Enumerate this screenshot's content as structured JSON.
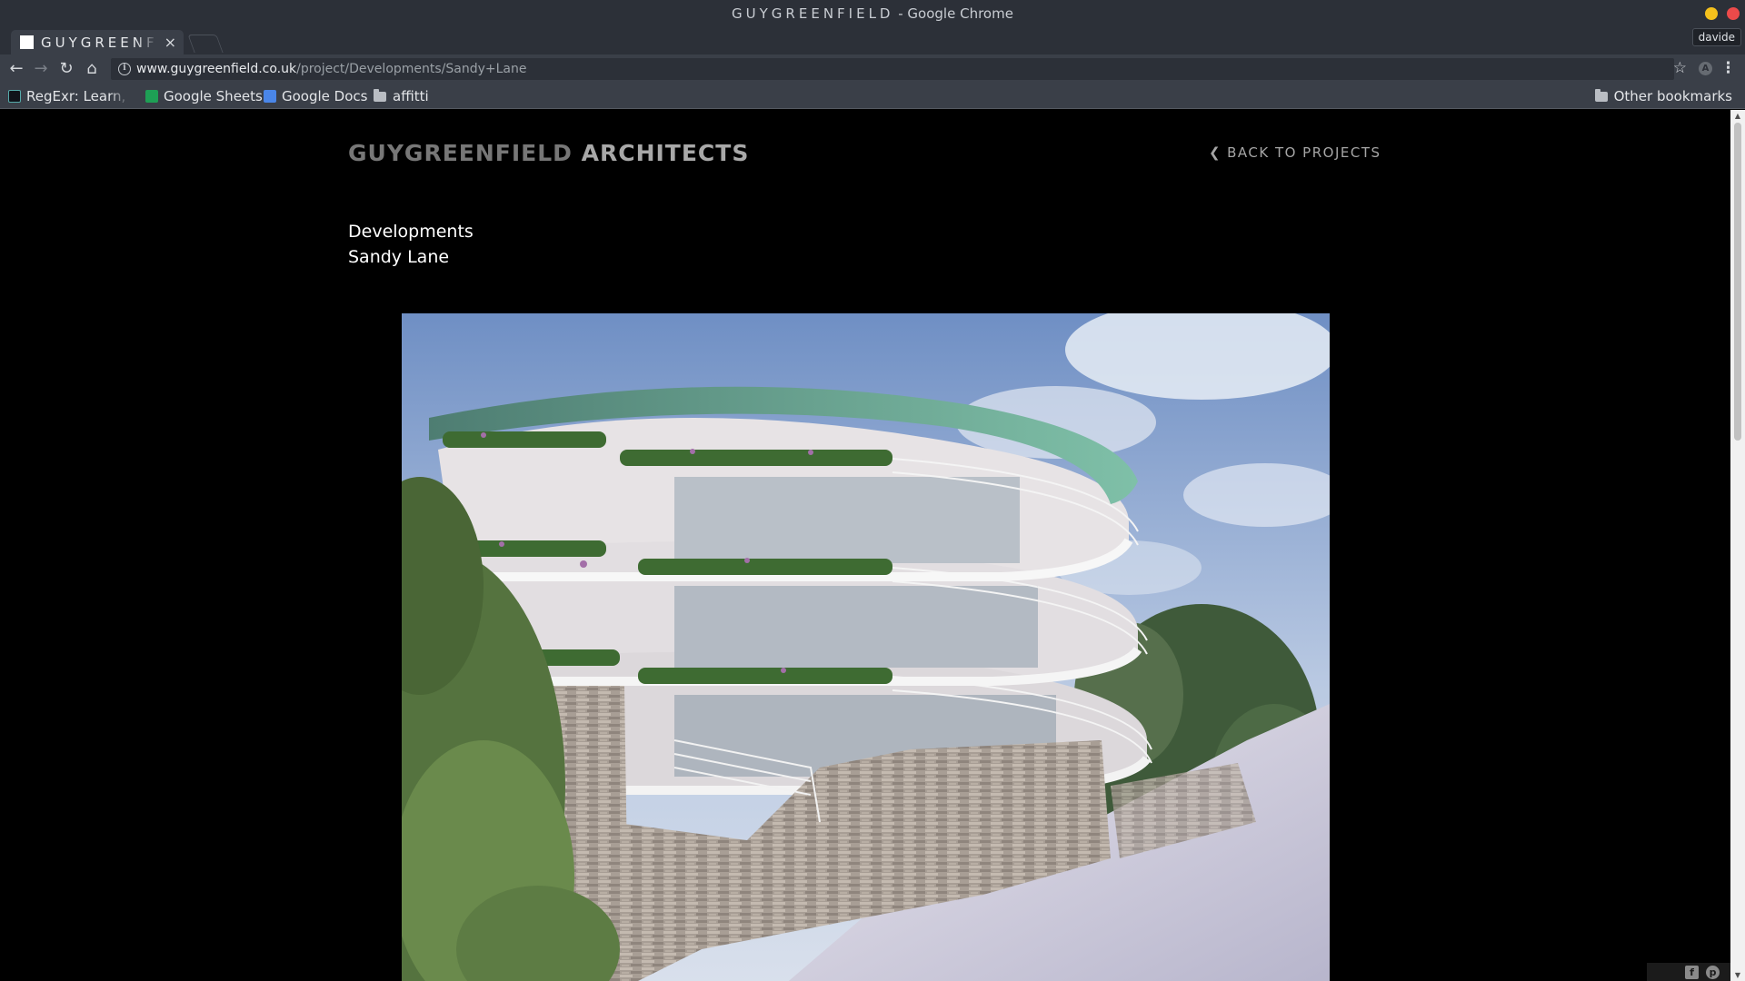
{
  "window": {
    "title_brand": "GUYGREENFIELD",
    "title_suffix": " - Google Chrome",
    "profile": "davide"
  },
  "tab": {
    "title": "GUYGREENFIELD",
    "close_symbol": "×"
  },
  "toolbar": {
    "url_host": "www.guygreenfield.co.uk",
    "url_path": "/project/Developments/Sandy+Lane",
    "back_symbol": "←",
    "forward_symbol": "→",
    "reload_symbol": "↻",
    "home_symbol": "⌂",
    "star_symbol": "☆",
    "menu_symbol": "⋮",
    "info_symbol": "i",
    "ext_letter": "A"
  },
  "bookmarks": {
    "items": [
      {
        "label": "RegExr: Learn, Build, & Test RegEx",
        "icon": "regexr-icon"
      },
      {
        "label": "Google Sheets",
        "icon": "google-sheets-icon"
      },
      {
        "label": "Google Docs",
        "icon": "google-docs-icon"
      },
      {
        "label": "affitti",
        "icon": "folder-icon"
      }
    ],
    "other": "Other bookmarks"
  },
  "site": {
    "logo_part1": "GUYGREENFIELD ",
    "logo_part2": "ARCHITECTS",
    "back_link": "BACK TO PROJECTS",
    "back_arrow_symbol": "❮",
    "project_category": "Developments",
    "project_name": "Sandy Lane",
    "share": {
      "facebook_symbol": "f",
      "pinterest_symbol": "p"
    }
  },
  "scrollbar": {
    "up_symbol": "▲",
    "down_symbol": "▼"
  },
  "colors": {
    "chrome_frame": "#2c3038",
    "chrome_toolbar": "#3a3f48",
    "page_background": "#000000",
    "logo_grey": "#777777",
    "logo_light": "#a8a8a8"
  }
}
